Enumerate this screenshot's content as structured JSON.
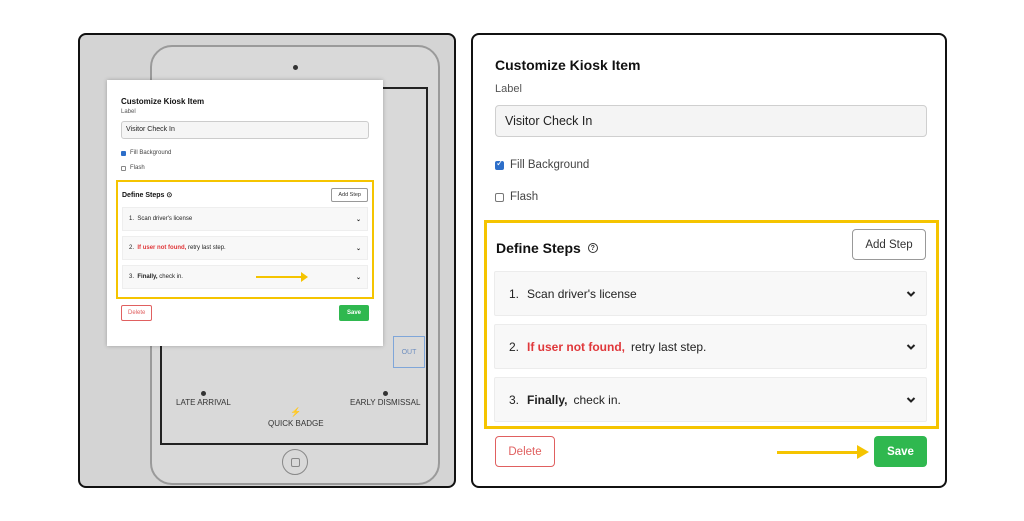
{
  "modal": {
    "title": "Customize Kiosk Item",
    "label_caption": "Label",
    "label_value": "Visitor Check In",
    "fill_background": {
      "label": "Fill Background",
      "checked": true
    },
    "flash": {
      "label": "Flash",
      "checked": false
    },
    "steps_title": "Define Steps",
    "add_step_label": "Add Step",
    "steps": [
      {
        "number": "1.",
        "emphasis": "",
        "text": "Scan driver's license",
        "emphasis_style": "none"
      },
      {
        "number": "2.",
        "emphasis": "If user not found,",
        "text": "retry last step.",
        "emphasis_style": "red"
      },
      {
        "number": "3.",
        "emphasis": "Finally,",
        "text": "check in.",
        "emphasis_style": "bold"
      }
    ],
    "delete_label": "Delete",
    "save_label": "Save"
  },
  "kiosk": {
    "late_arrival": "LATE ARRIVAL",
    "quick_badge": "QUICK BADGE",
    "early_dismissal": "EARLY DISMISSAL",
    "out_button_fragment": "OUT"
  },
  "colors": {
    "highlight": "#f5c400",
    "save": "#2fb84f",
    "delete": "#e06060",
    "emphasis_red": "#e0383b",
    "checkbox": "#2d6ec9"
  }
}
